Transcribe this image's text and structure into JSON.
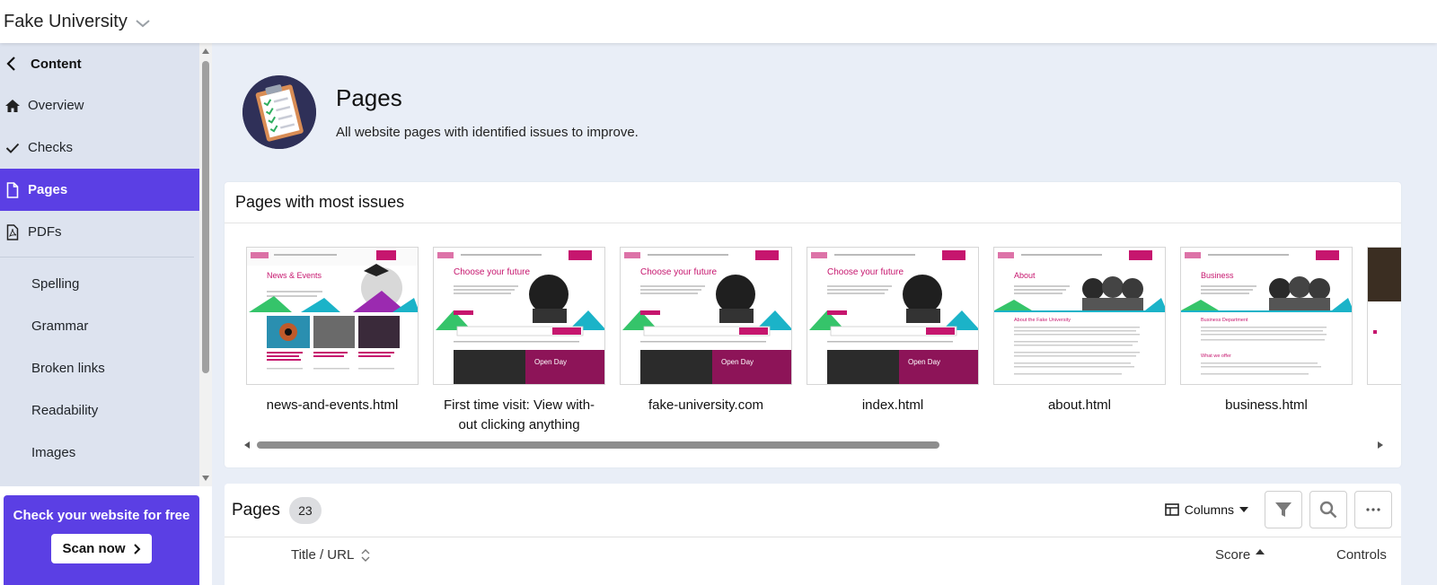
{
  "topbar": {
    "org_name": "Fake University"
  },
  "sidebar": {
    "section_title": "Content",
    "items": [
      {
        "label": "Overview",
        "icon": "home-icon"
      },
      {
        "label": "Checks",
        "icon": "check-icon"
      },
      {
        "label": "Pages",
        "icon": "page-icon",
        "active": true
      },
      {
        "label": "PDFs",
        "icon": "pdf-icon"
      }
    ],
    "sub_items": [
      "Spelling",
      "Grammar",
      "Broken links",
      "Readability",
      "Images"
    ]
  },
  "promo": {
    "title": "Check your website for free",
    "button_label": "Scan now"
  },
  "hero": {
    "title": "Pages",
    "subtitle": "All website pages with identified issues to improve."
  },
  "most_issues": {
    "title": "Pages with most issues",
    "thumbnails": [
      {
        "label": "news-and-events.html",
        "heading": "News & Events"
      },
      {
        "label": "First time visit: View with-out clicking anything",
        "heading": "Choose your future",
        "banner": "Open Day"
      },
      {
        "label": "fake-university.com",
        "heading": "Choose your future",
        "banner": "Open Day"
      },
      {
        "label": "index.html",
        "heading": "Choose your future",
        "banner": "Open Day"
      },
      {
        "label": "about.html",
        "heading": "About",
        "subheading": "About the Fake University"
      },
      {
        "label": "business.html",
        "heading": "Business",
        "subheading": "Business Department",
        "subheading2": "What we offer"
      }
    ]
  },
  "pages_table": {
    "title": "Pages",
    "count": "23",
    "columns_label": "Columns",
    "headers": {
      "title": "Title / URL",
      "score": "Score",
      "controls": "Controls"
    }
  },
  "colors": {
    "accent": "#5b3fe4",
    "brand_magenta": "#c6166e",
    "background": "#e9eef7"
  }
}
